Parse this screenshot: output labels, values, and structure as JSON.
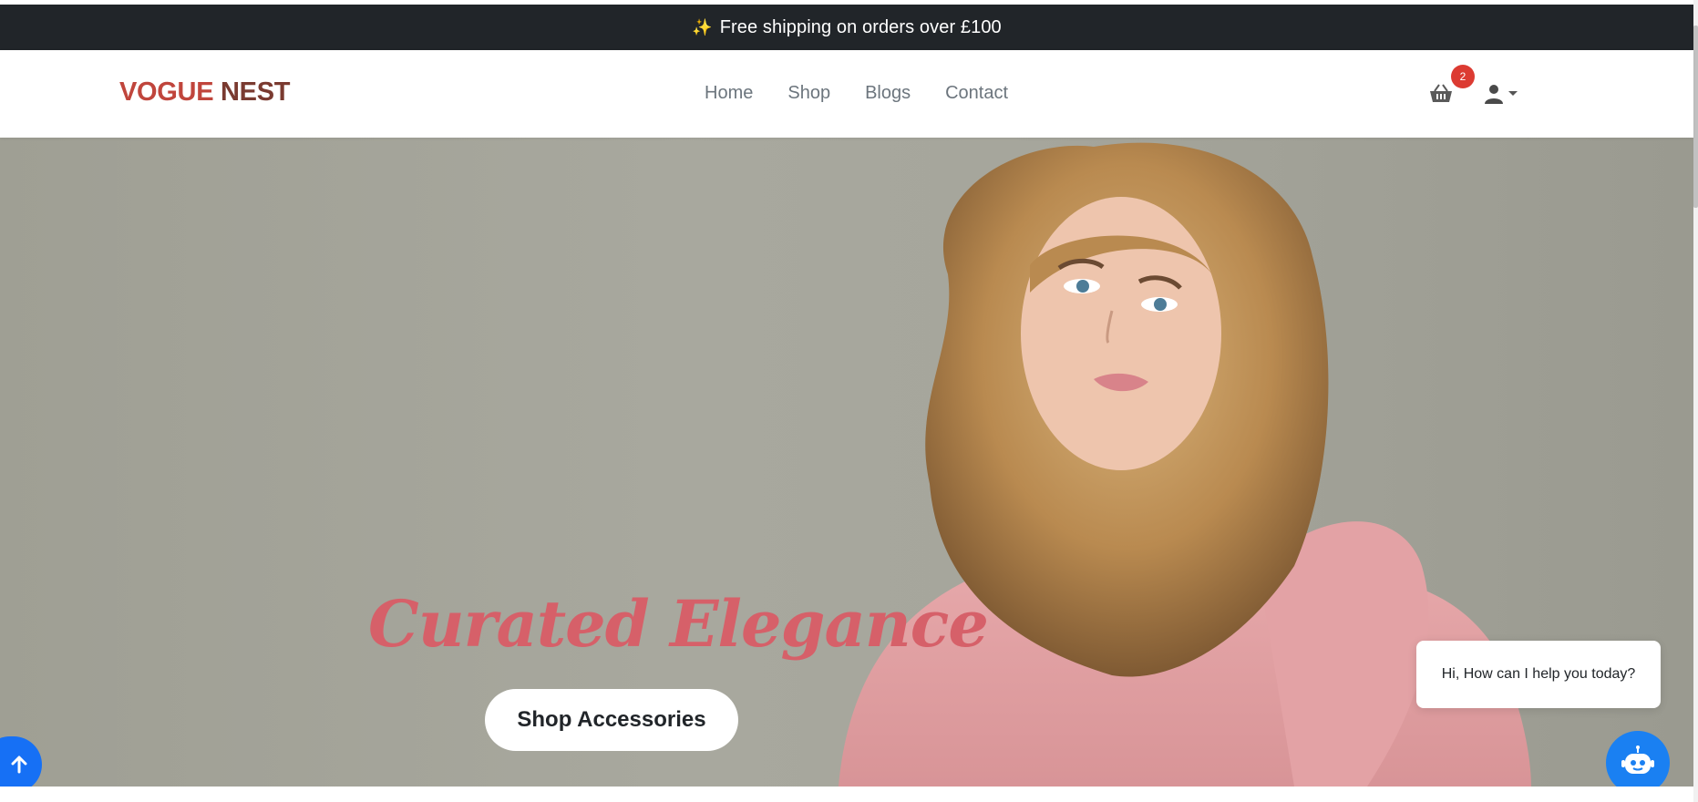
{
  "announcement": {
    "icon": "sparkles-icon",
    "text": "Free shipping on orders over £100"
  },
  "brand": {
    "part1": "VOGUE",
    "part2": "NEST"
  },
  "nav": {
    "items": [
      "Home",
      "Shop",
      "Blogs",
      "Contact"
    ]
  },
  "cart": {
    "icon": "basket-icon",
    "count": "2"
  },
  "user": {
    "icon": "user-icon"
  },
  "hero": {
    "title": "Curated Elegance",
    "button_label": "Shop Accessories"
  },
  "chat": {
    "greeting": "Hi, How can I help you today?",
    "icon": "chatbot-icon"
  },
  "scroll_top": {
    "icon": "arrow-up-icon"
  },
  "colors": {
    "announce_bg": "#212529",
    "brand_red": "#c0453c",
    "brand_brown": "#7a3a30",
    "hero_title": "#d66069",
    "accent_blue": "#1670f5",
    "badge_red": "#dc3b32"
  }
}
